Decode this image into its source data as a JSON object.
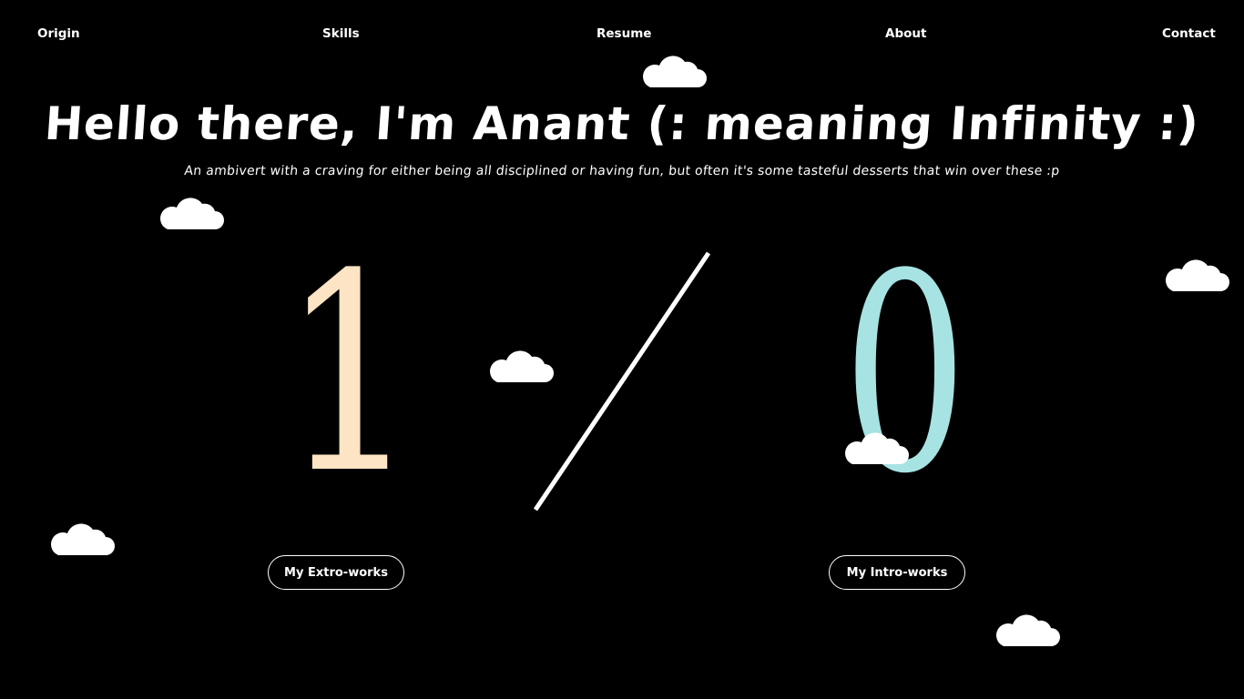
{
  "nav": {
    "items": [
      "Origin",
      "Skills",
      "Resume",
      "About",
      "Contact"
    ]
  },
  "hero": {
    "title": "Hello there, I'm Anant (: meaning Infinity :)",
    "subtitle": "An ambivert with a craving for either being all disciplined or having fun, but often it's some tasteful desserts that win over these :p"
  },
  "visual": {
    "left_digit": "1",
    "right_digit": "0",
    "left_digit_color": "#fde4c4",
    "right_digit_color": "#a6e3e2",
    "slash_color": "#ffffff"
  },
  "buttons": {
    "extro_label": "My Extro-works",
    "intro_label": "My Intro-works"
  },
  "icons": {
    "cloud": "cloud-icon"
  },
  "colors": {
    "background": "#000000",
    "text": "#ffffff"
  }
}
